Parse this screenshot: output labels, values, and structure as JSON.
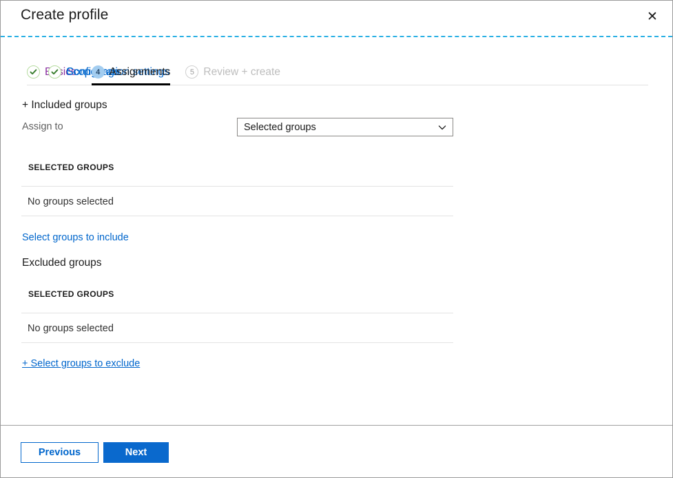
{
  "window": {
    "title": "Create profile",
    "close_icon": "close-icon",
    "accent_dashed_color": "#2ab0e4",
    "border_color": "#9a9a9a"
  },
  "wizard": {
    "tabs": [
      {
        "index": "1",
        "label": "Basics",
        "state": "visited",
        "badge": "check-circle-icon"
      },
      {
        "index": "2",
        "label": "Configuration settings",
        "state": "link",
        "badge": "check-circle-icon"
      },
      {
        "index": "3",
        "label": "Scope tags",
        "state": "link",
        "badge": "check-circle-icon"
      },
      {
        "index": "4",
        "label": "Assignments",
        "state": "current",
        "badge": "4"
      },
      {
        "index": "5",
        "label": "Review + create",
        "state": "disabled",
        "badge": "5"
      }
    ],
    "active_tab_index": 3,
    "active_underline_color": "#000000",
    "visited_color": "#8a2fa0",
    "link_color": "#0066cc",
    "disabled_color": "#bdbdbd",
    "check_color": "#367c2b",
    "check_ring_color": "#b6dca0",
    "active_badge_bg": "#a3cdf0"
  },
  "included": {
    "heading": "+ Included groups",
    "assign_to_label": "Assign to",
    "assign_to_value": "Selected groups",
    "assign_to_caret": "chevron-down-icon",
    "table_header": "SELECTED GROUPS",
    "empty_text": "No groups selected",
    "select_link": "Select groups to include"
  },
  "excluded": {
    "heading": "Excluded groups",
    "table_header": "SELECTED GROUPS",
    "empty_text": "No groups selected",
    "select_link": "+ Select groups to exclude"
  },
  "footer": {
    "previous_label": "Previous",
    "next_label": "Next",
    "primary_color": "#0a69cd",
    "secondary_border_color": "#0066cc"
  }
}
